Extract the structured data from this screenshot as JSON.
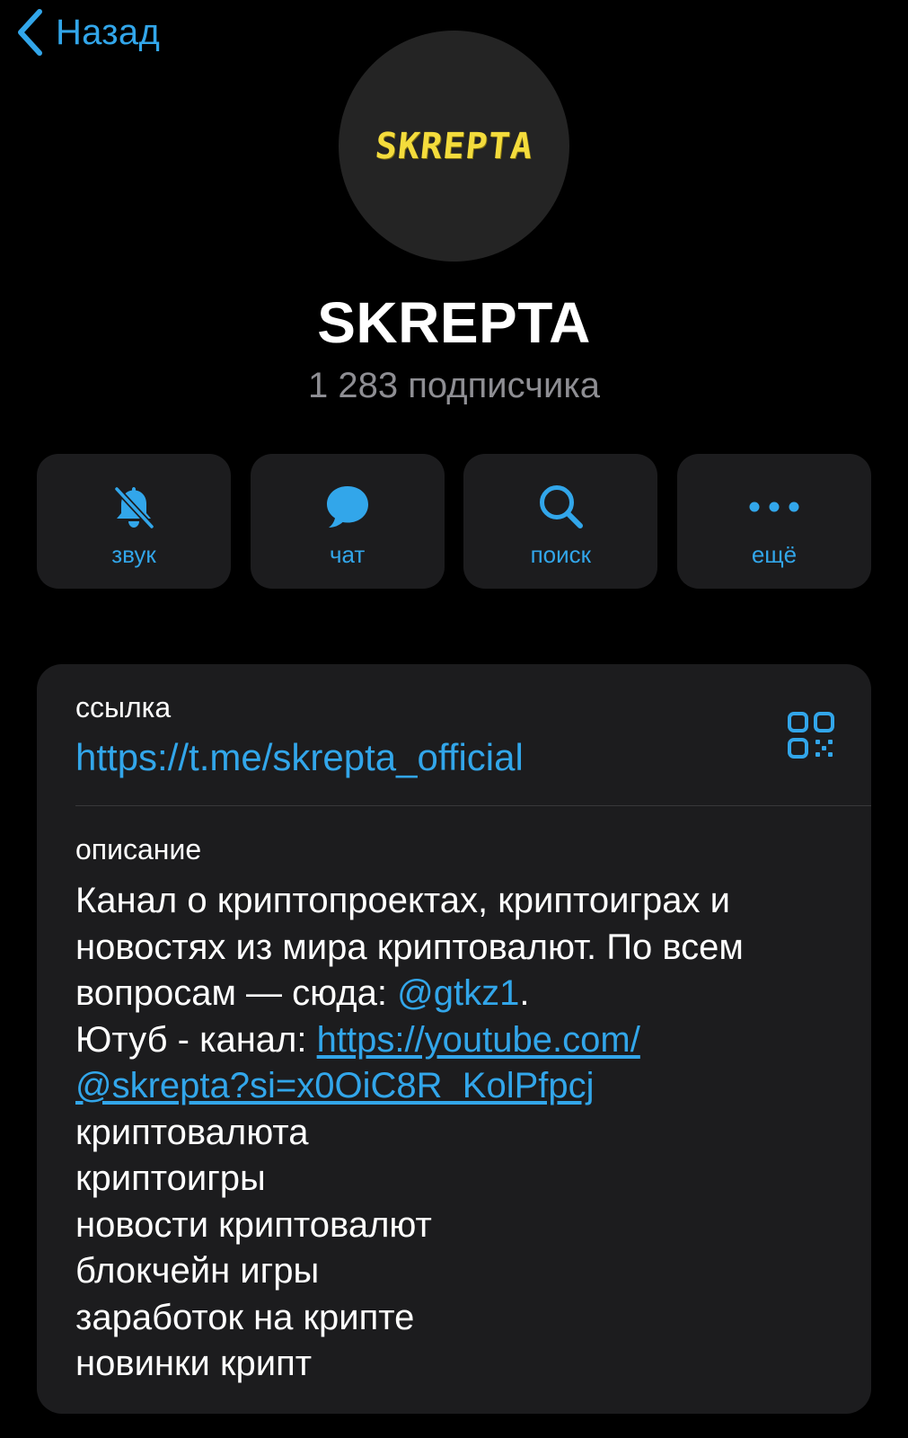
{
  "header": {
    "back_label": "Назад"
  },
  "channel": {
    "avatar_logo_text": "SKREPTA",
    "name": "SKREPTA",
    "subscribers": "1 283 подписчика"
  },
  "actions": [
    {
      "label": "звук",
      "icon": "bell-slash-icon"
    },
    {
      "label": "чат",
      "icon": "chat-bubble-icon"
    },
    {
      "label": "поиск",
      "icon": "search-icon"
    },
    {
      "label": "ещё",
      "icon": "more-dots-icon"
    }
  ],
  "info": {
    "link_label": "ссылка",
    "link_value": "https://t.me/skrepta_official",
    "description_label": "описание",
    "description": {
      "line1": "Канал о криптопроектах, криптоиграх и",
      "line2": "новостях из мира криптовалют. По всем",
      "line3_prefix": "вопросам — сюда: ",
      "line3_mention": "@gtkz1",
      "line3_suffix": ".",
      "line4_prefix": "Ютуб - канал: ",
      "line4_url": "https://youtube.com/",
      "line5_url": "@skrepta?si=x0OiC8R_KolPfpcj",
      "tags": [
        "криптовалюта",
        "криптоигры",
        "новости криптовалют",
        "блокчейн игры",
        "заработок на крипте",
        "новинки крипт"
      ]
    }
  },
  "colors": {
    "accent": "#32a6ea",
    "background": "#000000",
    "card": "#1c1c1e",
    "secondary_text": "#8e8e93",
    "logo_yellow": "#f4dc3c"
  }
}
